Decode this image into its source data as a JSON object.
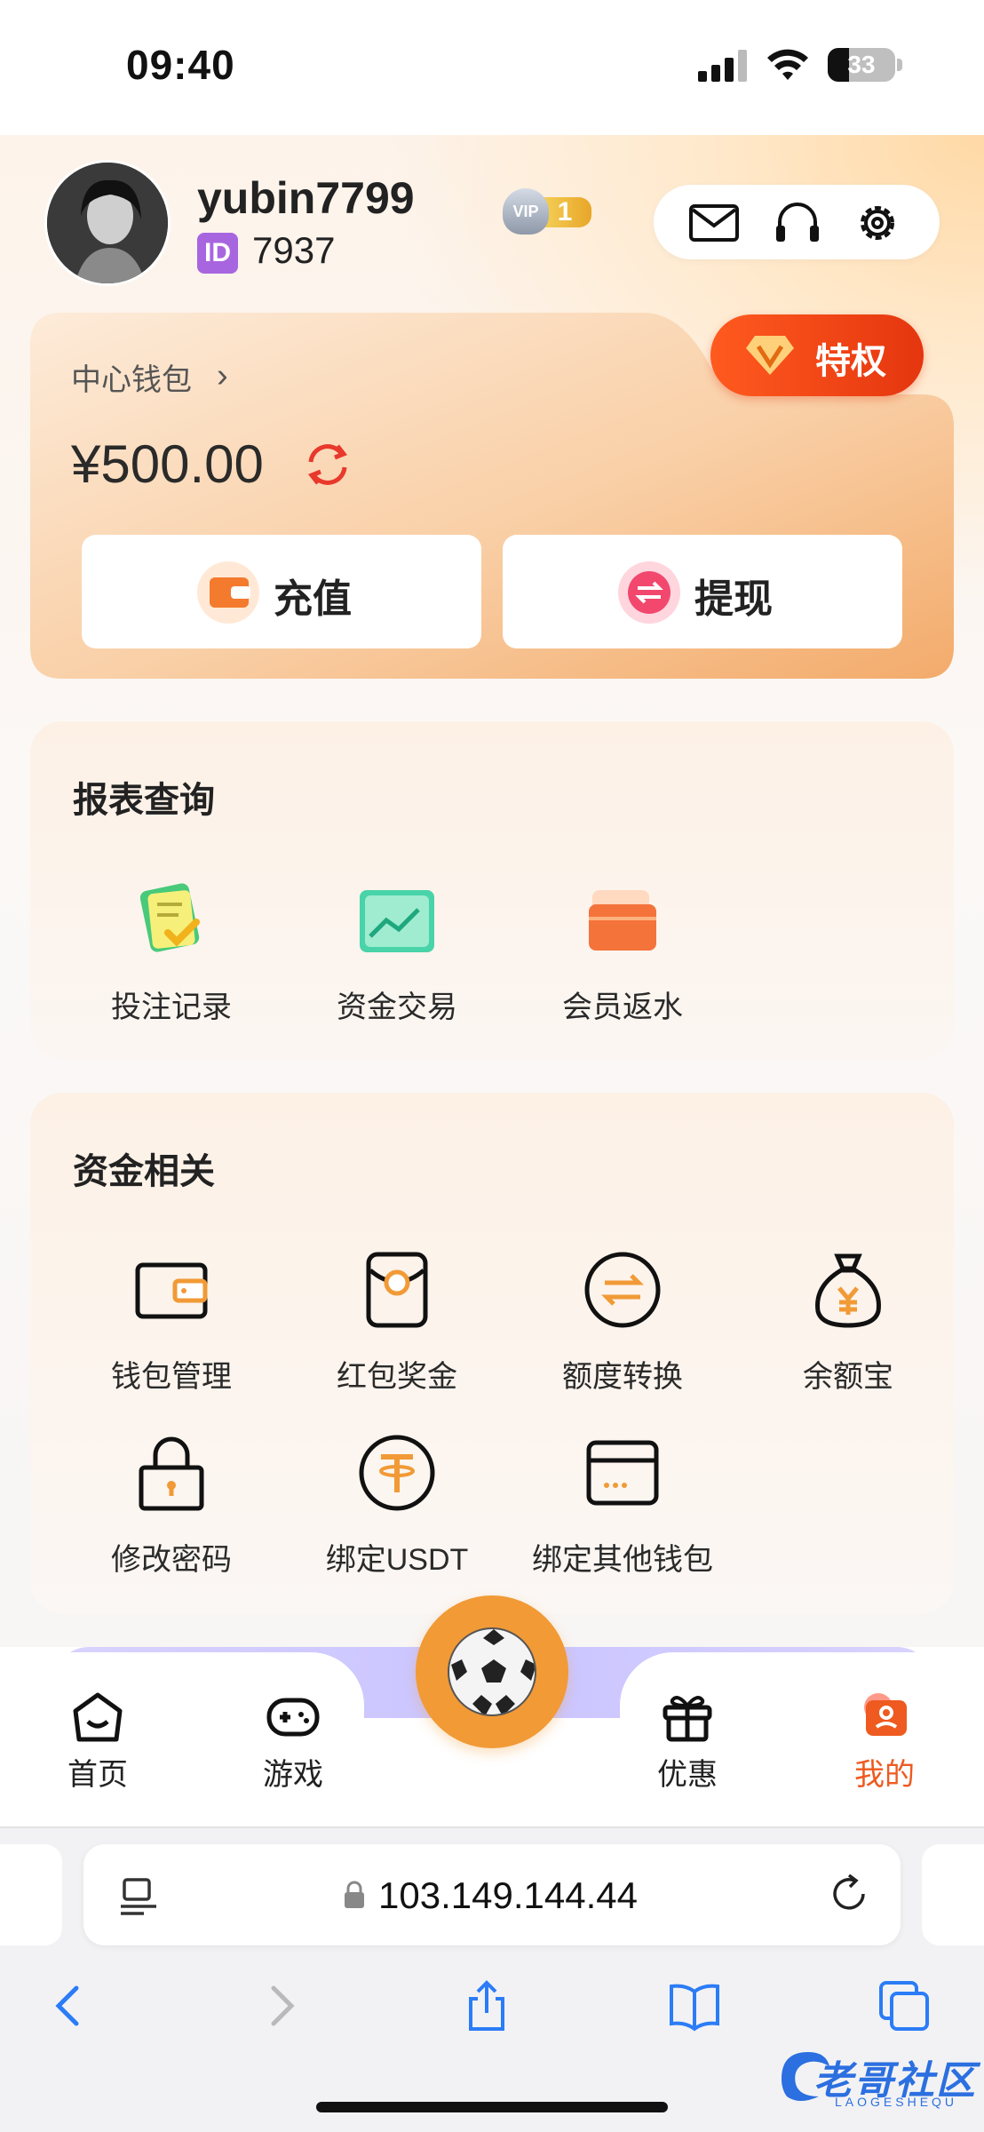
{
  "status_bar": {
    "time": "09:40",
    "battery": "33"
  },
  "profile": {
    "username": "yubin7799",
    "id_badge": "ID",
    "id_number": "7937",
    "vip_label": "VIP",
    "vip_level": "1"
  },
  "top_actions": [
    {
      "icon": "mail-icon"
    },
    {
      "icon": "headset-icon"
    },
    {
      "icon": "gear-icon"
    }
  ],
  "wallet": {
    "title": "中心钱包",
    "chevron": "›",
    "balance": "¥500.00",
    "privilege_label": "特权",
    "recharge_label": "充值",
    "withdraw_label": "提现"
  },
  "report": {
    "title": "报表查询",
    "items": [
      {
        "label": "投注记录",
        "icon": "bet-record-icon"
      },
      {
        "label": "资金交易",
        "icon": "fund-transaction-icon"
      },
      {
        "label": "会员返水",
        "icon": "member-rebate-icon"
      }
    ]
  },
  "finance": {
    "title": "资金相关",
    "items": [
      {
        "label": "钱包管理",
        "icon": "wallet-icon"
      },
      {
        "label": "红包奖金",
        "icon": "red-packet-icon"
      },
      {
        "label": "额度转换",
        "icon": "transfer-icon"
      },
      {
        "label": "余额宝",
        "icon": "money-bag-icon"
      },
      {
        "label": "修改密码",
        "icon": "lock-icon"
      },
      {
        "label": "绑定USDT",
        "icon": "usdt-icon"
      },
      {
        "label": "绑定其他钱包",
        "icon": "card-icon"
      }
    ]
  },
  "tabbar": {
    "items": [
      {
        "label": "首页",
        "icon": "home-icon"
      },
      {
        "label": "游戏",
        "icon": "gamepad-icon"
      },
      {
        "label": "优惠",
        "icon": "gift-icon"
      },
      {
        "label": "我的",
        "icon": "profile-icon"
      }
    ],
    "active": "我的",
    "active_color": "#ee5a1f"
  },
  "browser": {
    "url": "103.149.144.44"
  },
  "watermark": {
    "text": "老哥社区",
    "sub": "LAOGESHEQU"
  },
  "colors": {
    "accent_orange": "#f19a36",
    "privilege_red": "#e5360f",
    "vip_gold": "#e8a629"
  }
}
